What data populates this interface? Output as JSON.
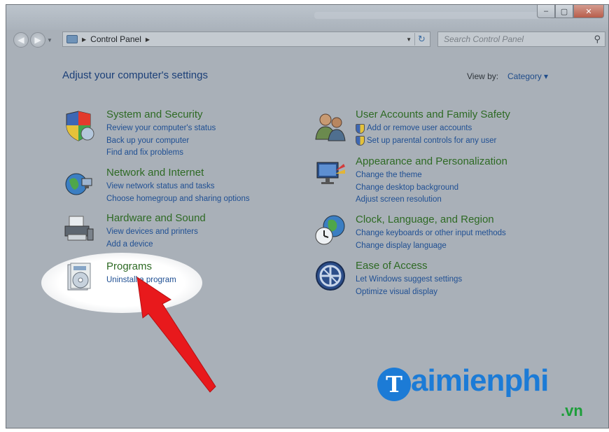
{
  "window": {
    "caption_buttons": [
      "–",
      "▢",
      "✕"
    ]
  },
  "nav": {
    "breadcrumb": "Control Panel",
    "search_placeholder": "Search Control Panel"
  },
  "header": {
    "heading": "Adjust your computer's settings",
    "view_by_label": "View by:",
    "view_by_value": "Category ▾"
  },
  "categories_left": [
    {
      "title": "System and Security",
      "icon": "shield-security-icon",
      "links": [
        "Review your computer's status",
        "Back up your computer",
        "Find and fix problems"
      ]
    },
    {
      "title": "Network and Internet",
      "icon": "globe-network-icon",
      "links": [
        "View network status and tasks",
        "Choose homegroup and sharing options"
      ]
    },
    {
      "title": "Hardware and Sound",
      "icon": "printer-icon",
      "links": [
        "View devices and printers",
        "Add a device"
      ]
    },
    {
      "title": "Programs",
      "icon": "programs-icon",
      "links": [
        "Uninstall a program"
      ]
    }
  ],
  "categories_right": [
    {
      "title": "User Accounts and Family Safety",
      "icon": "users-icon",
      "links": [
        "Add or remove user accounts",
        "Set up parental controls for any user"
      ]
    },
    {
      "title": "Appearance and Personalization",
      "icon": "display-icon",
      "links": [
        "Change the theme",
        "Change desktop background",
        "Adjust screen resolution"
      ]
    },
    {
      "title": "Clock, Language, and Region",
      "icon": "clock-globe-icon",
      "links": [
        "Change keyboards or other input methods",
        "Change display language"
      ]
    },
    {
      "title": "Ease of Access",
      "icon": "ease-of-access-icon",
      "links": [
        "Let Windows suggest settings",
        "Optimize visual display"
      ]
    }
  ],
  "watermark": {
    "logo_letter": "T",
    "text": "aimienphi",
    "suffix": ".vn"
  },
  "colors": {
    "category_title": "#2e6a24",
    "link": "#1f4f93",
    "arrow": "#e8191c",
    "brand_blue": "#1c7bd6",
    "brand_green": "#1d9e3a"
  }
}
